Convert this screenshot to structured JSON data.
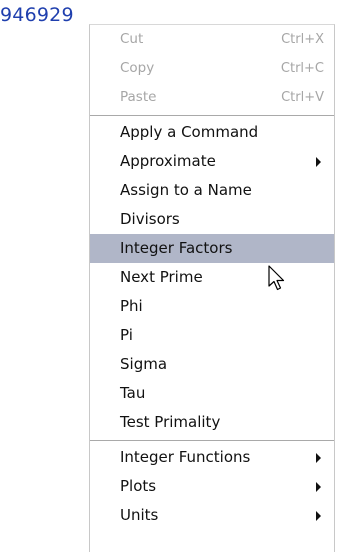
{
  "document": {
    "value": "946929"
  },
  "menu": {
    "edit_items": [
      {
        "label": "Cut",
        "shortcut": "Ctrl+X"
      },
      {
        "label": "Copy",
        "shortcut": "Ctrl+C"
      },
      {
        "label": "Paste",
        "shortcut": "Ctrl+V"
      }
    ],
    "items": [
      {
        "label": "Apply a Command"
      },
      {
        "label": "Approximate"
      },
      {
        "label": "Assign to a Name"
      },
      {
        "label": "Divisors"
      },
      {
        "label": "Integer Factors"
      },
      {
        "label": "Next Prime"
      },
      {
        "label": "Phi"
      },
      {
        "label": "Pi"
      },
      {
        "label": "Sigma"
      },
      {
        "label": "Tau"
      },
      {
        "label": "Test Primality"
      }
    ],
    "submenus": [
      {
        "label": "Integer Functions"
      },
      {
        "label": "Plots"
      },
      {
        "label": "Units"
      }
    ]
  },
  "colors": {
    "highlight": "#b0b6c8",
    "value_text": "#1f3fae",
    "disabled_text": "#a6a6a6"
  },
  "icons": {
    "cursor": "arrow-pointer-icon",
    "submenu_arrow": "chevron-right-icon"
  }
}
